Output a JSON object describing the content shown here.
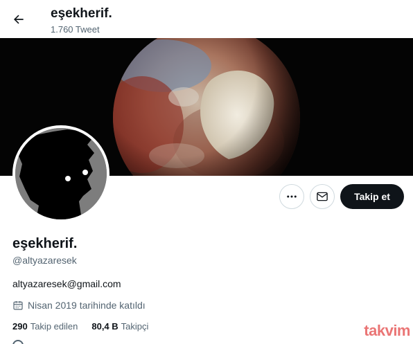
{
  "header": {
    "name": "eşekherif.",
    "tweet_count": "1.760 Tweet"
  },
  "profile": {
    "display_name": "eşekherif.",
    "handle": "@altyazaresek",
    "bio": "altyazaresek@gmail.com",
    "joined": "Nisan 2019 tarihinde katıldı",
    "following_count": "290",
    "following_label": "Takip edilen",
    "followers_count": "80,4 B",
    "followers_label": "Takipçi"
  },
  "actions": {
    "follow_label": "Takip et"
  },
  "watermark": {
    "text": "takvim"
  },
  "icons": {
    "back": "arrow-left-icon",
    "more": "more-dots-icon",
    "message": "envelope-icon",
    "calendar": "calendar-icon"
  },
  "colors": {
    "primary_text": "#0f1419",
    "secondary_text": "#536471",
    "border": "#cfd9de",
    "follow_button_bg": "#0f1419",
    "watermark": "#e23b3b"
  }
}
